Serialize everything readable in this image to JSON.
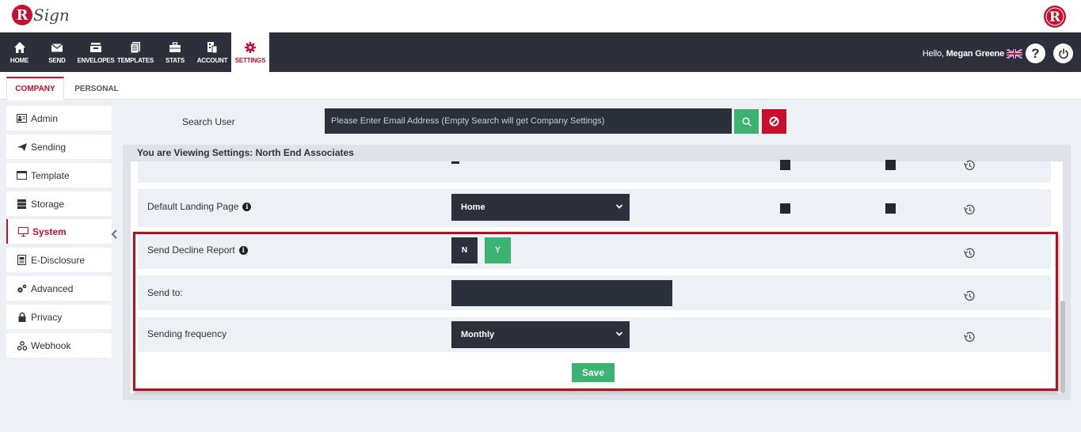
{
  "brand": {
    "logo_letter": "R",
    "logo_text": "Sign",
    "accent": "#c8102e"
  },
  "nav": {
    "items": [
      {
        "label": "HOME",
        "icon": "home-icon"
      },
      {
        "label": "SEND",
        "icon": "envelope-icon"
      },
      {
        "label": "ENVELOPES",
        "icon": "inbox-icon"
      },
      {
        "label": "TEMPLATES",
        "icon": "templates-icon"
      },
      {
        "label": "STATS",
        "icon": "briefcase-icon"
      },
      {
        "label": "ACCOUNT",
        "icon": "account-icon"
      },
      {
        "label": "SETTINGS",
        "icon": "gear-icon"
      }
    ],
    "active": "SETTINGS",
    "greeting": "Hello,",
    "user_name": "Megan Greene"
  },
  "tabs": [
    {
      "label": "COMPANY",
      "active": true
    },
    {
      "label": "PERSONAL",
      "active": false
    }
  ],
  "sidebar": {
    "items": [
      {
        "label": "Admin",
        "icon": "admin-icon"
      },
      {
        "label": "Sending",
        "icon": "paper-plane-icon"
      },
      {
        "label": "Template",
        "icon": "template-icon"
      },
      {
        "label": "Storage",
        "icon": "storage-icon"
      },
      {
        "label": "System",
        "icon": "monitor-icon",
        "active": true
      },
      {
        "label": "E-Disclosure",
        "icon": "document-icon"
      },
      {
        "label": "Advanced",
        "icon": "cogs-icon"
      },
      {
        "label": "Privacy",
        "icon": "lock-icon"
      },
      {
        "label": "Webhook",
        "icon": "webhook-icon"
      }
    ]
  },
  "search": {
    "label": "Search User",
    "placeholder": "Please Enter Email Address (Empty Search will get Company Settings)",
    "value": ""
  },
  "settings": {
    "viewing_title": "You are Viewing Settings: North End Associates",
    "landing_label": "Default Landing Page",
    "landing_value": "Home",
    "decline_label": "Send Decline Report",
    "decline_no": "N",
    "decline_yes": "Y",
    "decline_selected": "Y",
    "send_to_label": "Send to:",
    "send_to_value": "",
    "frequency_label": "Sending frequency",
    "frequency_value": "Monthly",
    "save_label": "Save"
  },
  "colors": {
    "dark": "#2b303b",
    "green": "#3cb371",
    "red": "#c8102e",
    "highlight": "#b0121f"
  }
}
